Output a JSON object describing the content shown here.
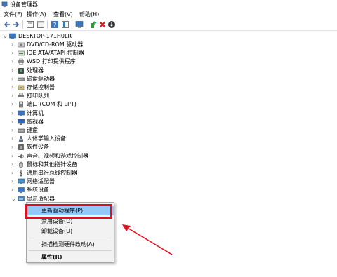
{
  "window": {
    "title": "设备管理器"
  },
  "menu": [
    "文件(F)",
    "操作(A)",
    "查看(V)",
    "帮助(H)"
  ],
  "toolbar": [
    "back-icon",
    "forward-icon",
    "properties-icon",
    "console-icon",
    "help-icon",
    "view-icon",
    "monitor-icon",
    "update-driver-icon",
    "uninstall-icon",
    "download-icon"
  ],
  "tree": {
    "root": "DESKTOP-171H0LR",
    "items": [
      {
        "label": "DVD/CD-ROM 驱动器",
        "icon": "disc-drive-icon"
      },
      {
        "label": "IDE ATA/ATAPI 控制器",
        "icon": "ide-controller-icon"
      },
      {
        "label": "WSD 打印提供程序",
        "icon": "printer-icon"
      },
      {
        "label": "处理器",
        "icon": "processor-icon"
      },
      {
        "label": "磁盘驱动器",
        "icon": "disk-drive-icon"
      },
      {
        "label": "存储控制器",
        "icon": "storage-controller-icon"
      },
      {
        "label": "打印队列",
        "icon": "print-queue-icon"
      },
      {
        "label": "端口 (COM 和 LPT)",
        "icon": "port-icon"
      },
      {
        "label": "计算机",
        "icon": "computer-icon"
      },
      {
        "label": "监视器",
        "icon": "monitor-icon"
      },
      {
        "label": "键盘",
        "icon": "keyboard-icon"
      },
      {
        "label": "人体学输入设备",
        "icon": "hid-icon"
      },
      {
        "label": "软件设备",
        "icon": "software-device-icon"
      },
      {
        "label": "声音、视频和游戏控制器",
        "icon": "sound-icon"
      },
      {
        "label": "鼠标和其他指针设备",
        "icon": "mouse-icon"
      },
      {
        "label": "通用串行总线控制器",
        "icon": "usb-icon"
      },
      {
        "label": "网络适配器",
        "icon": "network-icon"
      },
      {
        "label": "系统设备",
        "icon": "system-device-icon"
      },
      {
        "label": "显示适配器",
        "icon": "display-adapter-icon",
        "expanded": true
      }
    ]
  },
  "context_menu": {
    "items": [
      "更新驱动程序(P)",
      "禁用设备(D)",
      "卸载设备(U)",
      "扫描检测硬件改动(A)",
      "属性(R)"
    ]
  },
  "colors": {
    "highlight": "#91c9f7",
    "annotation_red": "#e0101e"
  }
}
